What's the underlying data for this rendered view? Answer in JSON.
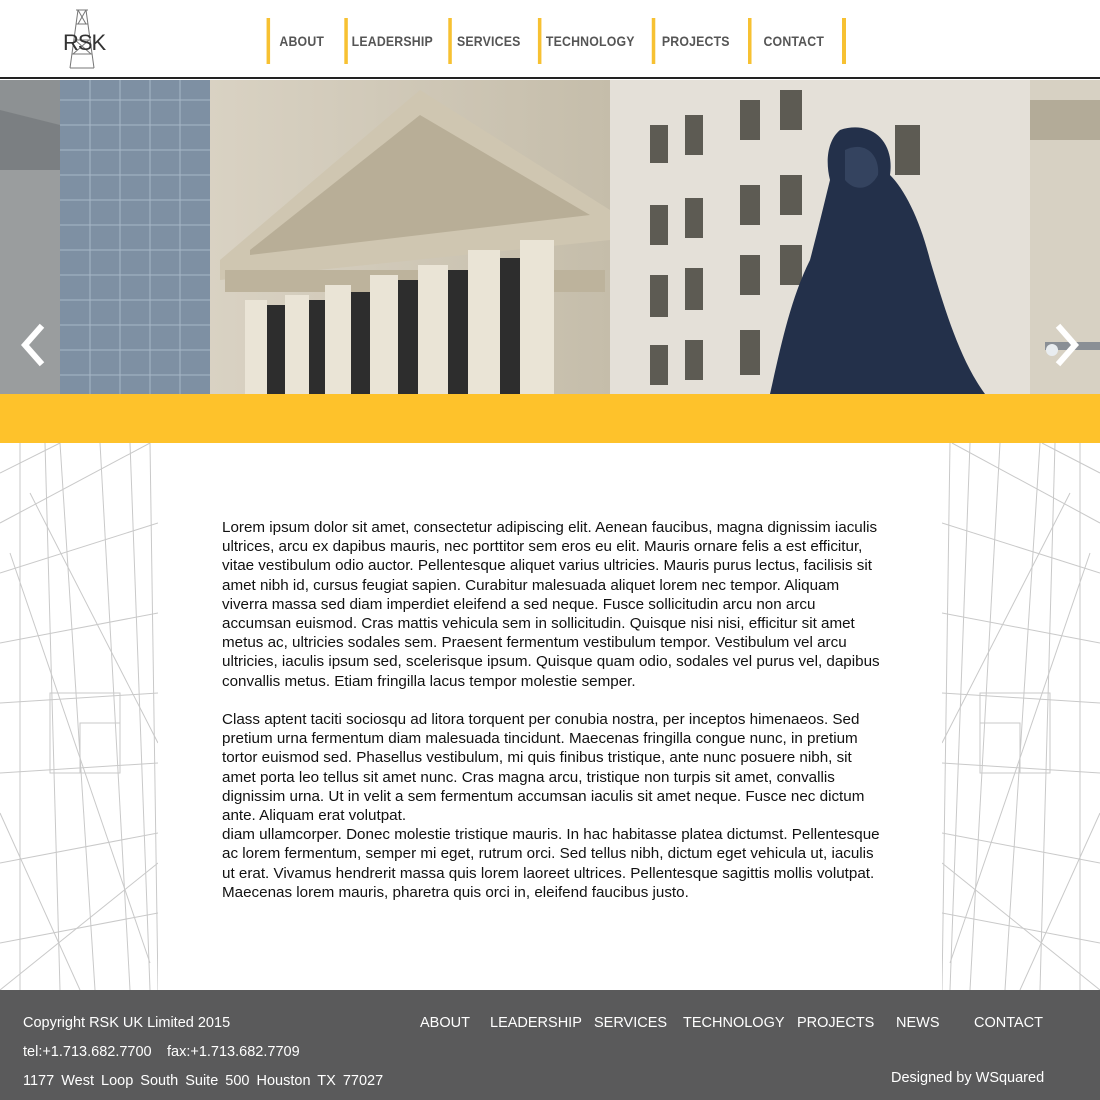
{
  "header": {
    "logo_text": "RSK",
    "nav": [
      {
        "label": "ABOUT",
        "name": "nav-about"
      },
      {
        "label": "LEADERSHIP",
        "name": "nav-leadership"
      },
      {
        "label": "SERVICES",
        "name": "nav-services"
      },
      {
        "label": "TECHNOLOGY",
        "name": "nav-technology"
      },
      {
        "label": "PROJECTS",
        "name": "nav-projects"
      },
      {
        "label": "CONTACT",
        "name": "nav-contact"
      }
    ]
  },
  "hero": {
    "prev_icon": "chevron-left-icon",
    "next_icon": "chevron-right-icon"
  },
  "content": {
    "paragraph_1": "Lorem ipsum dolor sit amet, consectetur adipiscing elit. Aenean faucibus, magna dignissim iaculis ultrices, arcu ex dapibus mauris, nec porttitor sem eros eu elit. Mauris ornare felis a est efficitur, vitae vestibulum odio auctor. Pellentesque aliquet varius ultricies. Mauris purus lectus, facilisis sit amet nibh id, cursus feugiat sapien. Curabitur malesuada aliquet lorem nec tempor. Aliquam viverra massa sed diam imperdiet eleifend a sed neque. Fusce sollicitudin arcu non arcu accumsan euismod. Cras mattis vehicula sem in sollicitudin. Quisque nisi nisi, efficitur sit amet metus ac, ultricies sodales sem. Praesent fermentum vestibulum tempor. Vestibulum vel arcu ultricies, iaculis ipsum sed, scelerisque ipsum. Quisque quam odio, sodales vel purus vel, dapibus convallis metus. Etiam fringilla lacus tempor molestie semper.",
    "paragraph_2": "Class aptent taciti sociosqu ad litora torquent per conubia nostra, per inceptos himenaeos. Sed pretium urna fermentum diam malesuada tincidunt. Maecenas fringilla congue nunc, in pretium tortor euismod sed. Phasellus vestibulum, mi quis finibus tristique, ante nunc posuere nibh, sit amet porta leo tellus sit amet nunc. Cras magna arcu, tristique non turpis sit amet, convallis dignissim urna. Ut in velit a sem fermentum accumsan iaculis sit amet neque. Fusce nec dictum ante. Aliquam erat volutpat.",
    "paragraph_3": "diam ullamcorper. Donec molestie tristique mauris. In hac habitasse platea dictumst. Pellentesque ac lorem fermentum, semper mi eget, rutrum orci. Sed tellus nibh, dictum eget vehicula ut, iaculis ut erat. Vivamus hendrerit massa quis lorem laoreet ultrices. Pellentesque sagittis mollis volutpat. Maecenas lorem mauris, pharetra quis orci in, eleifend faucibus justo."
  },
  "footer": {
    "copyright": "Copyright RSK UK Limited 2015",
    "tel": "tel:+1.713.682.7700",
    "fax": "fax:+1.713.682.7709",
    "address": "1177 West Loop South Suite 500 Houston TX 77027",
    "nav": [
      "ABOUT",
      "LEADERSHIP",
      "SERVICES",
      "TECHNOLOGY",
      "PROJECTS",
      "NEWS",
      "CONTACT"
    ],
    "designed_by": "Designed by WSquared"
  },
  "colors": {
    "accent_yellow": "#fec22b",
    "nav_divider": "#f7c132",
    "footer_bg": "#5a5a5b"
  }
}
